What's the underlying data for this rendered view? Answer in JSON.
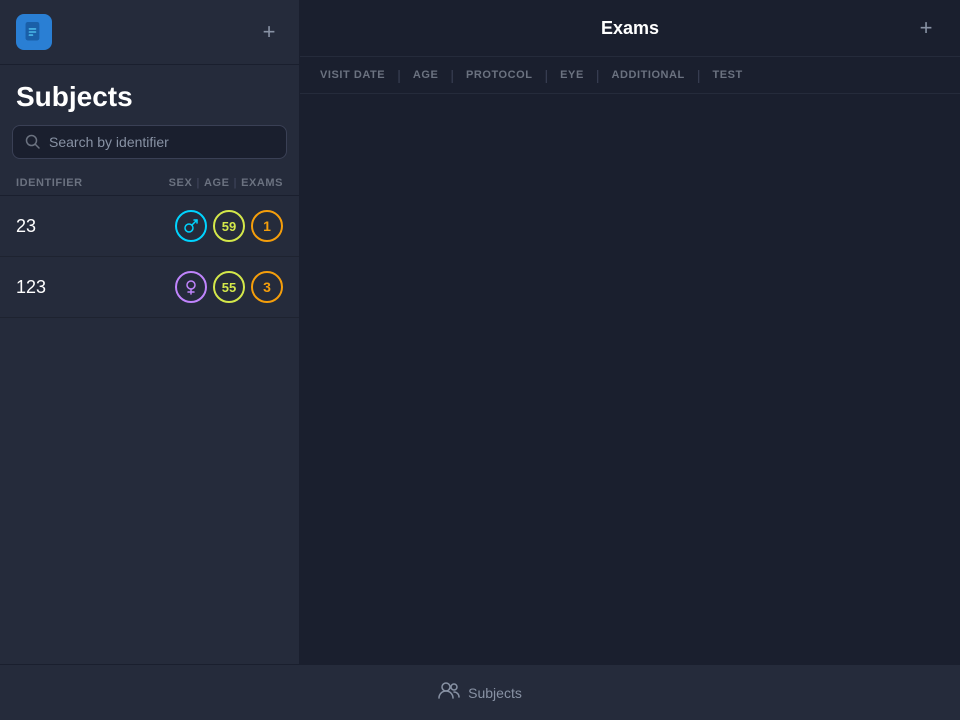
{
  "app": {
    "logo_alt": "CSV App Logo"
  },
  "sidebar": {
    "title": "Subjects",
    "add_label": "+",
    "search_placeholder": "Search by identifier",
    "table_columns": {
      "identifier": "IDENTIFIER",
      "sex": "SEX",
      "age": "AGE",
      "exams": "EXAMS"
    },
    "subjects": [
      {
        "id": "23",
        "gender": "male",
        "gender_symbol": "♂",
        "age": "59",
        "exams_count": "1"
      },
      {
        "id": "123",
        "gender": "female",
        "gender_symbol": "♀",
        "age": "55",
        "exams_count": "3"
      }
    ]
  },
  "main": {
    "title": "Exams",
    "add_label": "+",
    "columns": [
      {
        "label": "VISIT DATE"
      },
      {
        "label": "AGE"
      },
      {
        "label": "PROTOCOL"
      },
      {
        "label": "EYE"
      },
      {
        "label": "ADDITIONAL"
      },
      {
        "label": "TEST"
      }
    ]
  },
  "bottom_bar": {
    "icon": "👥",
    "label": "Subjects"
  }
}
